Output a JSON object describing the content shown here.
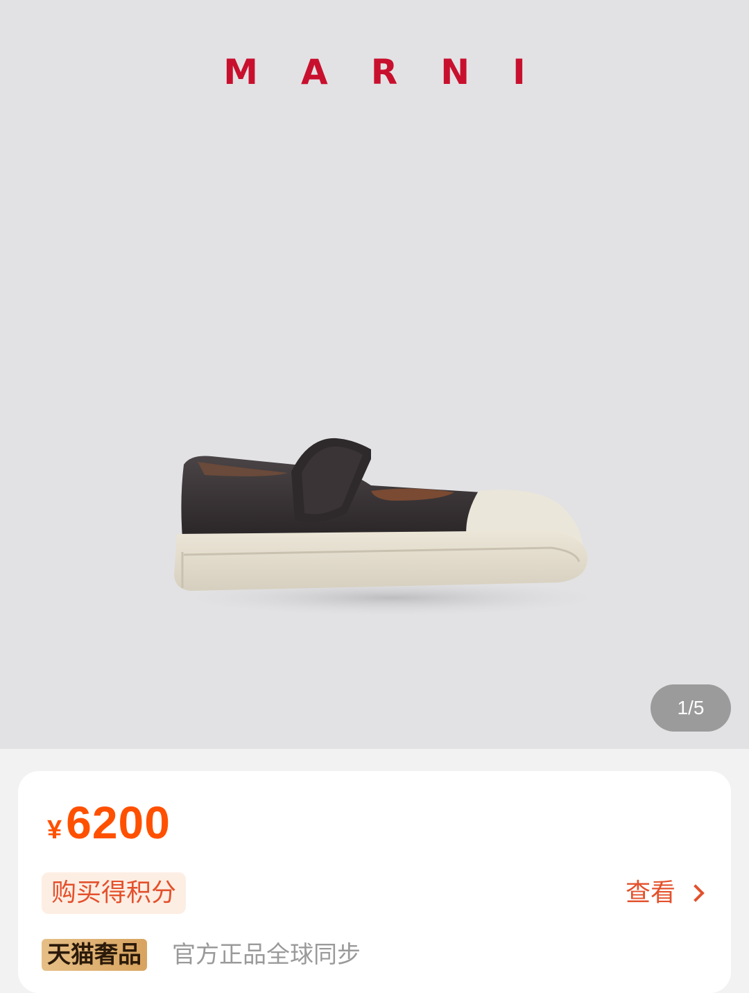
{
  "gallery": {
    "brand_logo_text": "MARNI",
    "image_counter": "1/5",
    "colors": {
      "background": "#e2e2e4",
      "brand_red": "#c8102e"
    }
  },
  "product": {
    "currency_symbol": "¥",
    "price": "6200",
    "points_label": "购买得积分",
    "view_link": "查看",
    "tmall_badge": "天猫奢品",
    "tagline": "官方正品全球同步",
    "colors": {
      "price": "#ff5000",
      "accent": "#e3512c",
      "badge_gold": "#e6bf86"
    }
  }
}
